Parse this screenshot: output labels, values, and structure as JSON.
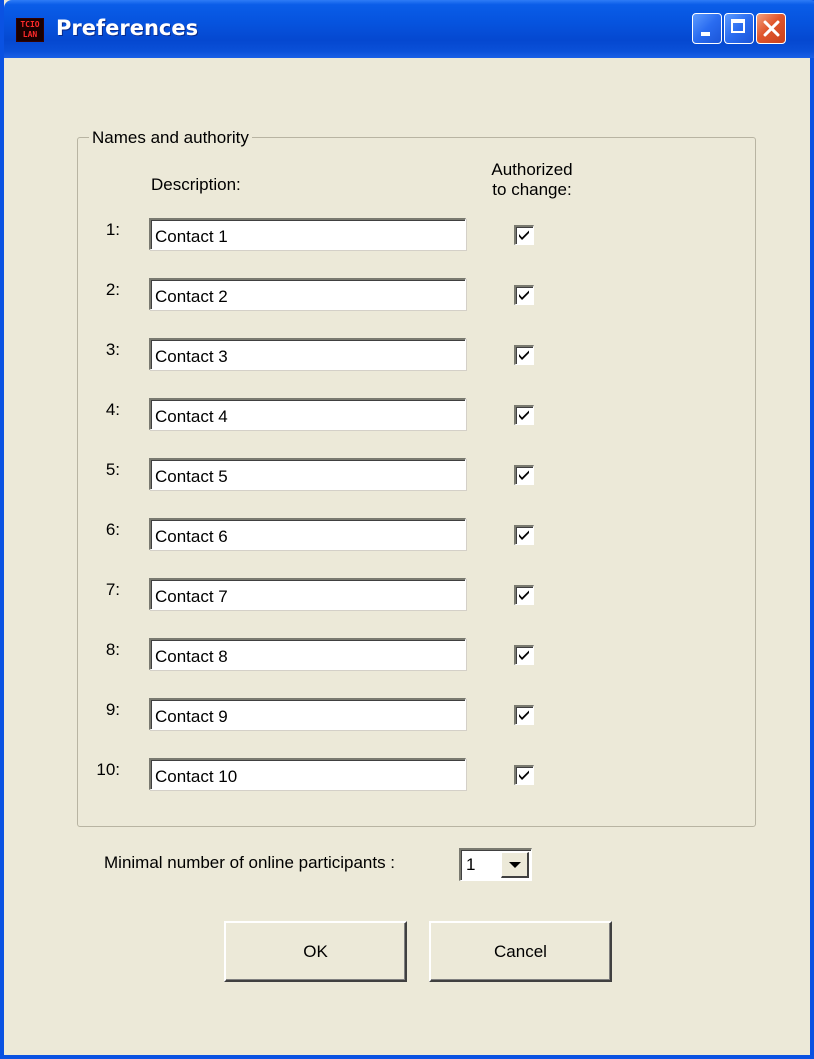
{
  "window": {
    "title": "Preferences",
    "app_icon_text_top": "TCIO",
    "app_icon_text_bottom": "LAN"
  },
  "group": {
    "legend": "Names and authority",
    "description_header": "Description:",
    "authorized_header_line1": "Authorized",
    "authorized_header_line2": "to change:"
  },
  "rows": [
    {
      "label": "1:",
      "value": "Contact 1",
      "authorized": true
    },
    {
      "label": "2:",
      "value": "Contact 2",
      "authorized": true
    },
    {
      "label": "3:",
      "value": "Contact 3",
      "authorized": true
    },
    {
      "label": "4:",
      "value": "Contact 4",
      "authorized": true
    },
    {
      "label": "5:",
      "value": "Contact 5",
      "authorized": true
    },
    {
      "label": "6:",
      "value": "Contact 6",
      "authorized": true
    },
    {
      "label": "7:",
      "value": "Contact 7",
      "authorized": true
    },
    {
      "label": "8:",
      "value": "Contact 8",
      "authorized": true
    },
    {
      "label": "9:",
      "value": "Contact 9",
      "authorized": true
    },
    {
      "label": "10:",
      "value": "Contact 10",
      "authorized": true
    }
  ],
  "min_participants": {
    "label": "Minimal number of online participants :",
    "value": "1"
  },
  "buttons": {
    "ok": "OK",
    "cancel": "Cancel"
  }
}
